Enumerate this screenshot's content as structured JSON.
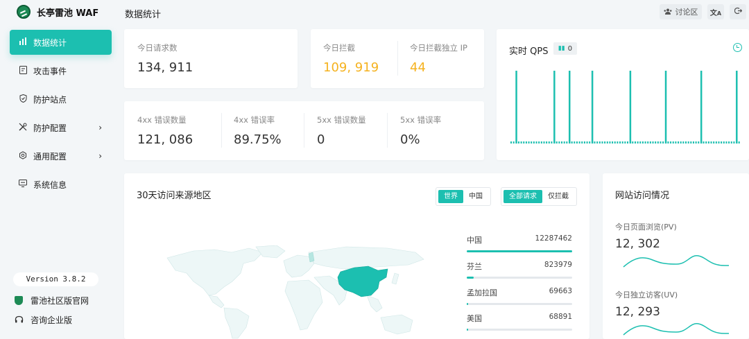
{
  "brand": {
    "name": "长亭雷池 WAF"
  },
  "header": {
    "title": "数据统计",
    "discuss_label": "讨论区"
  },
  "nav": [
    {
      "label": "数据统计",
      "icon": "bar-chart-icon",
      "active": true,
      "arrow": false
    },
    {
      "label": "攻击事件",
      "icon": "event-icon",
      "active": false,
      "arrow": false
    },
    {
      "label": "防护站点",
      "icon": "shield-icon",
      "active": false,
      "arrow": false
    },
    {
      "label": "防护配置",
      "icon": "tools-icon",
      "active": false,
      "arrow": true
    },
    {
      "label": "通用配置",
      "icon": "gear-icon",
      "active": false,
      "arrow": true
    },
    {
      "label": "系统信息",
      "icon": "monitor-icon",
      "active": false,
      "arrow": false
    }
  ],
  "footer": {
    "version": "Version 3.8.2",
    "community": "雷池社区版官网",
    "enterprise": "咨询企业版"
  },
  "stats_top": {
    "requests": {
      "label": "今日请求数",
      "value": "134, 911"
    },
    "blocked": {
      "label": "今日拦截",
      "value": "109, 919"
    },
    "blocked_ip": {
      "label": "今日拦截独立 IP",
      "value": "44"
    }
  },
  "stats_errors": [
    {
      "label": "4xx 错误数量",
      "value": "121, 086"
    },
    {
      "label": "4xx 错误率",
      "value": "89.75%"
    },
    {
      "label": "5xx 错误数量",
      "value": "0"
    },
    {
      "label": "5xx 错误率",
      "value": "0%"
    }
  ],
  "qps": {
    "title": "实时 QPS",
    "current": "0"
  },
  "chart_data": {
    "type": "bar",
    "title": "实时 QPS",
    "spike_positions": [
      2,
      17,
      23,
      32,
      47,
      61,
      75,
      89
    ],
    "total_slots": 92,
    "series": [
      {
        "values_note_free": true
      }
    ]
  },
  "map": {
    "title": "30天访问来源地区",
    "scope_tabs": [
      "世界",
      "中国"
    ],
    "scope_active": 0,
    "type_tabs": [
      "全部请求",
      "仅拦截"
    ],
    "type_active": 0,
    "ranking": [
      {
        "name": "中国",
        "value": "12287462",
        "ratio": 1.0
      },
      {
        "name": "芬兰",
        "value": "823979",
        "ratio": 0.067
      },
      {
        "name": "孟加拉国",
        "value": "69663",
        "ratio": 0.006
      },
      {
        "name": "美国",
        "value": "68891",
        "ratio": 0.006
      }
    ]
  },
  "site_access": {
    "title": "网站访问情况",
    "pv_label": "今日页面浏览(PV)",
    "pv_value": "12, 302",
    "uv_label": "今日独立访客(UV)",
    "uv_value": "12, 293"
  },
  "colors": {
    "accent": "#1cbfb0",
    "orange": "#f5b21f",
    "china_fill": "#1cbfb0",
    "map_land": "#eaf6f6"
  }
}
